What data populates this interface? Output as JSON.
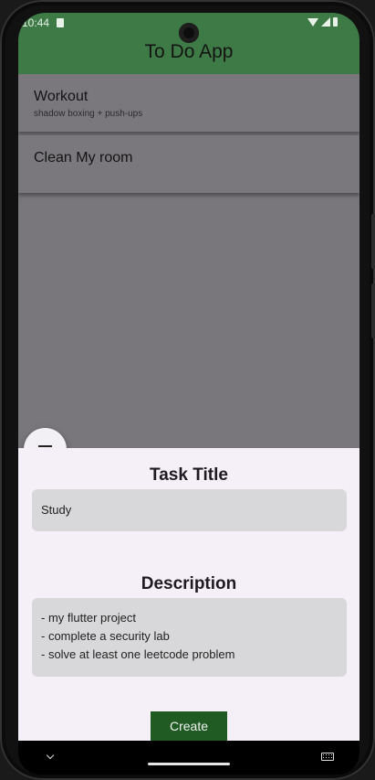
{
  "status_bar": {
    "time": "10:44"
  },
  "app_bar": {
    "title": "To Do App",
    "color": "#3e7a46"
  },
  "tasks": [
    {
      "title": "Workout",
      "description": "shadow boxing + push-ups"
    },
    {
      "title": "Clean My room",
      "description": ""
    }
  ],
  "fab": {
    "icon": "menu-icon"
  },
  "sheet": {
    "title_heading": "Task Title",
    "title_value": "Study",
    "description_heading": "Description",
    "description_lines": [
      "- my flutter project",
      "- complete a security lab",
      "- solve at least one leetcode problem"
    ],
    "create_label": "Create",
    "create_color": "#1f5b23"
  },
  "nav_bar": {
    "icons": [
      "back-icon",
      "home-handle",
      "keyboard-icon"
    ]
  }
}
